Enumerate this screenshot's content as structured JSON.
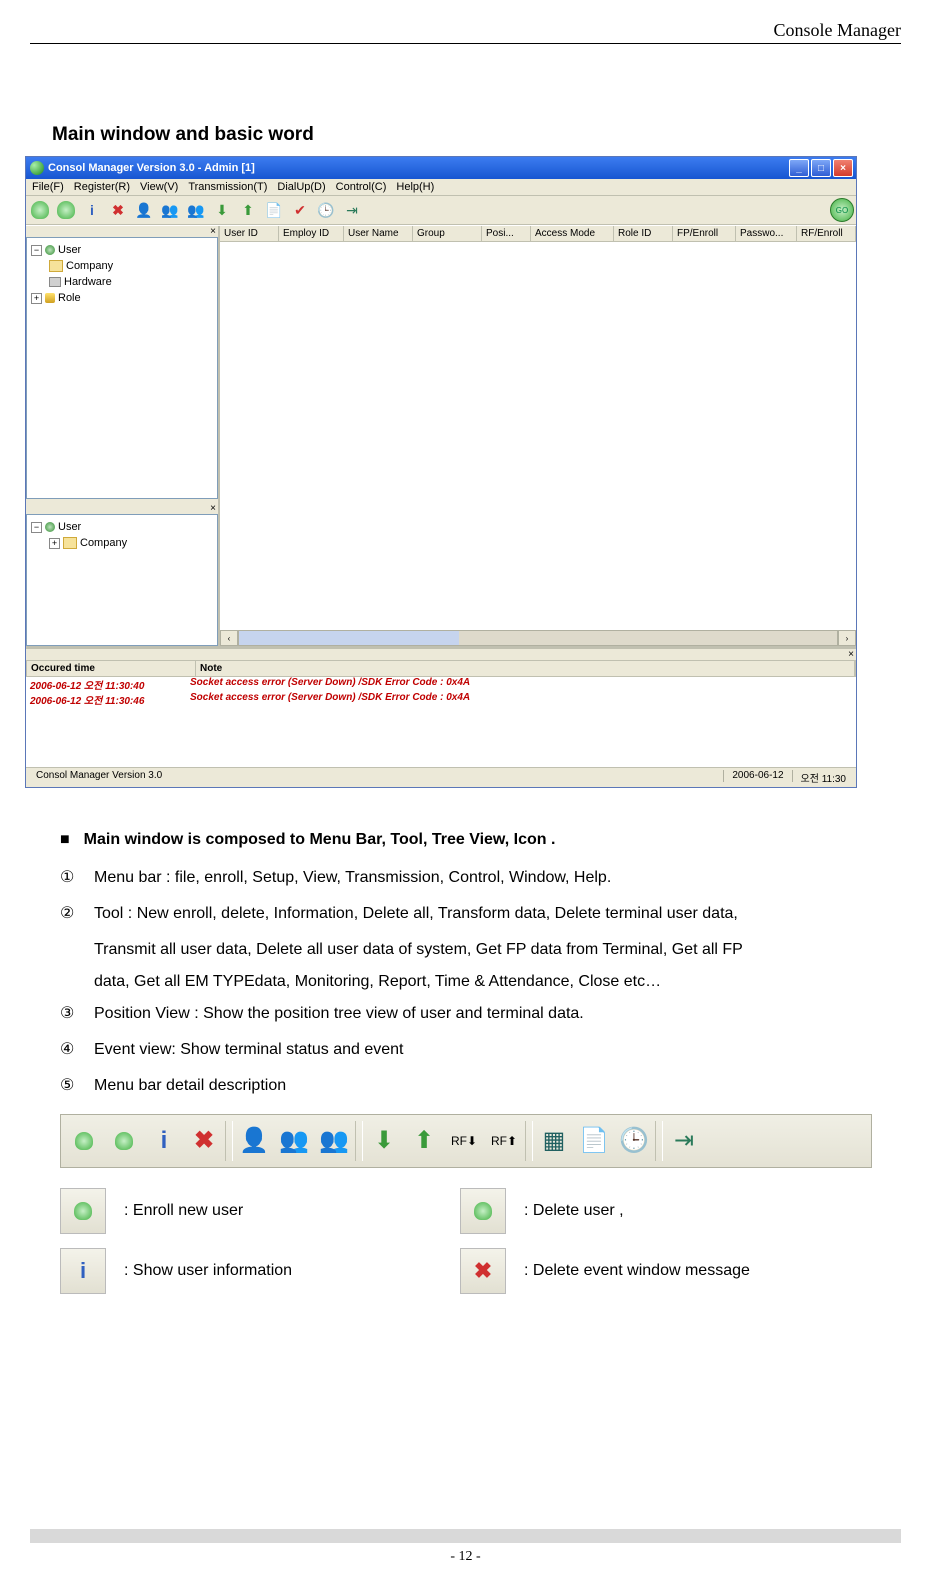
{
  "header": {
    "running_title": "Console Manager"
  },
  "section_title": "Main window and basic word",
  "window": {
    "title": "Consol Manager Version 3.0 - Admin [1]",
    "menu": [
      "File(F)",
      "Register(R)",
      "View(V)",
      "Transmission(T)",
      "DialUp(D)",
      "Control(C)",
      "Help(H)"
    ],
    "tree1": {
      "root": "User",
      "items": [
        "Company",
        "Hardware"
      ],
      "root2": "Role"
    },
    "tree2": {
      "root": "User",
      "items": [
        "Company"
      ]
    },
    "grid_columns": [
      "User ID",
      "Employ ID",
      "User Name",
      "Group",
      "Posi...",
      "Access Mode",
      "Role ID",
      "FP/Enroll",
      "Passwo...",
      "RF/Enroll"
    ],
    "events": {
      "cols": [
        "Occured time",
        "Note"
      ],
      "rows": [
        {
          "time": "2006-06-12 오전 11:30:40",
          "note": "Socket access error (Server Down) /SDK Error Code : 0x4A"
        },
        {
          "time": "2006-06-12 오전 11:30:46",
          "note": "Socket access error (Server Down) /SDK Error Code : 0x4A"
        }
      ]
    },
    "status": {
      "app": "Consol Manager Version 3.0",
      "date": "2006-06-12",
      "clock": "오전 11:30"
    },
    "go_label": "GO"
  },
  "body": {
    "bullet": "Main window is composed to Menu Bar, Tool, Tree View, Icon .",
    "items": [
      {
        "num": "①",
        "text": "Menu bar : file, enroll, Setup, View, Transmission, Control, Window, Help."
      },
      {
        "num": "②",
        "text": "Tool : New enroll, delete, Information, Delete all, Transform data, Delete terminal user data,"
      },
      {
        "num": "",
        "text": "Transmit all user data, Delete all user data of system, Get FP data from Terminal, Get all FP"
      },
      {
        "num": "",
        "text": "data, Get all EM TYPEdata, Monitoring, Report, Time & Attendance, Close etc…"
      },
      {
        "num": "③",
        "text": "Position View : Show the position tree view of user and terminal data."
      },
      {
        "num": "④",
        "text": "Event view: Show terminal status and event"
      },
      {
        "num": "⑤",
        "text": "Menu bar detail description"
      }
    ]
  },
  "legend": {
    "rows": [
      {
        "l": ": Enroll new user",
        "r": ": Delete user ,"
      },
      {
        "l": ": Show user information",
        "r": ": Delete event window message"
      }
    ]
  },
  "footer": {
    "page": "- 12 -"
  }
}
